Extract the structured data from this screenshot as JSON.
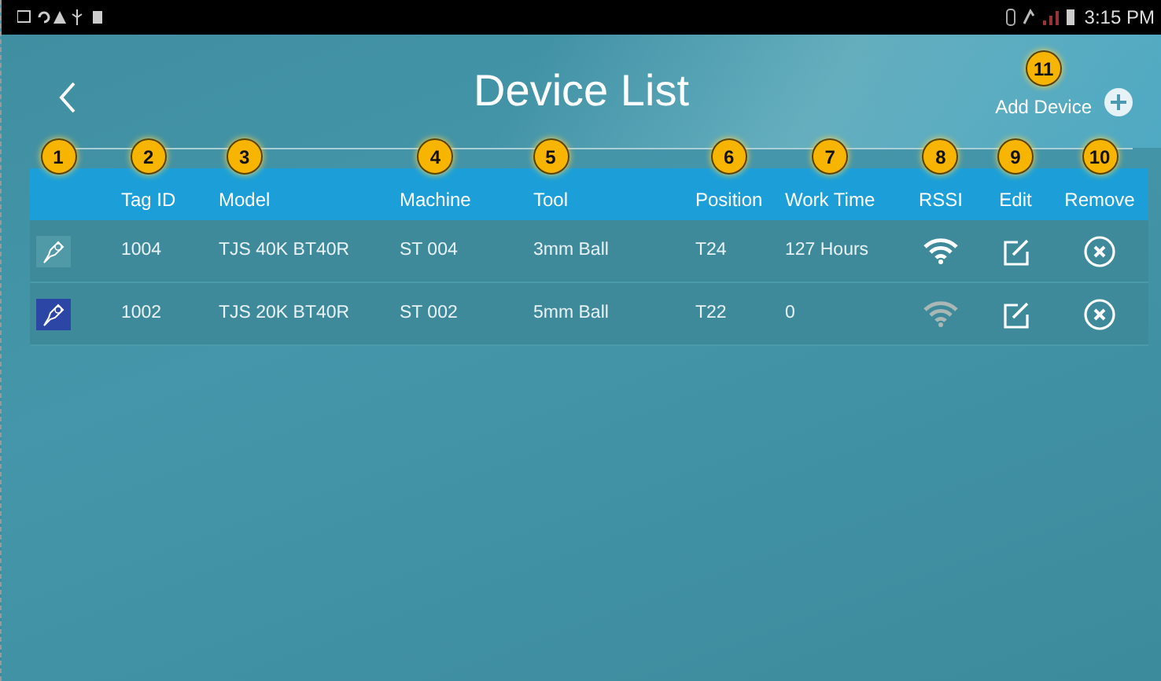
{
  "status_bar": {
    "time": "3:15 PM"
  },
  "title": "Device List",
  "add_device": {
    "label": "Add Device",
    "callout": "11"
  },
  "columns": [
    {
      "callout": "1"
    },
    {
      "label": "Tag ID",
      "callout": "2"
    },
    {
      "label": "Model",
      "callout": "3"
    },
    {
      "label": "Machine",
      "callout": "4"
    },
    {
      "label": "Tool",
      "callout": "5"
    },
    {
      "label": "Position",
      "callout": "6"
    },
    {
      "label": "Work Time",
      "callout": "7"
    },
    {
      "label": "RSSI",
      "callout": "8"
    },
    {
      "label": "Edit",
      "callout": "9"
    },
    {
      "label": "Remove",
      "callout": "10"
    }
  ],
  "rows": [
    {
      "selected": false,
      "tag_id": "1004",
      "model": "TJS 40K BT40R",
      "machine": "ST 004",
      "tool": "3mm Ball",
      "position": "T24",
      "work_time": "127 Hours",
      "connected": true
    },
    {
      "selected": true,
      "tag_id": "1002",
      "model": "TJS 20K BT40R",
      "machine": "ST 002",
      "tool": "5mm Ball",
      "position": "T22",
      "work_time": "0",
      "connected": false
    }
  ]
}
